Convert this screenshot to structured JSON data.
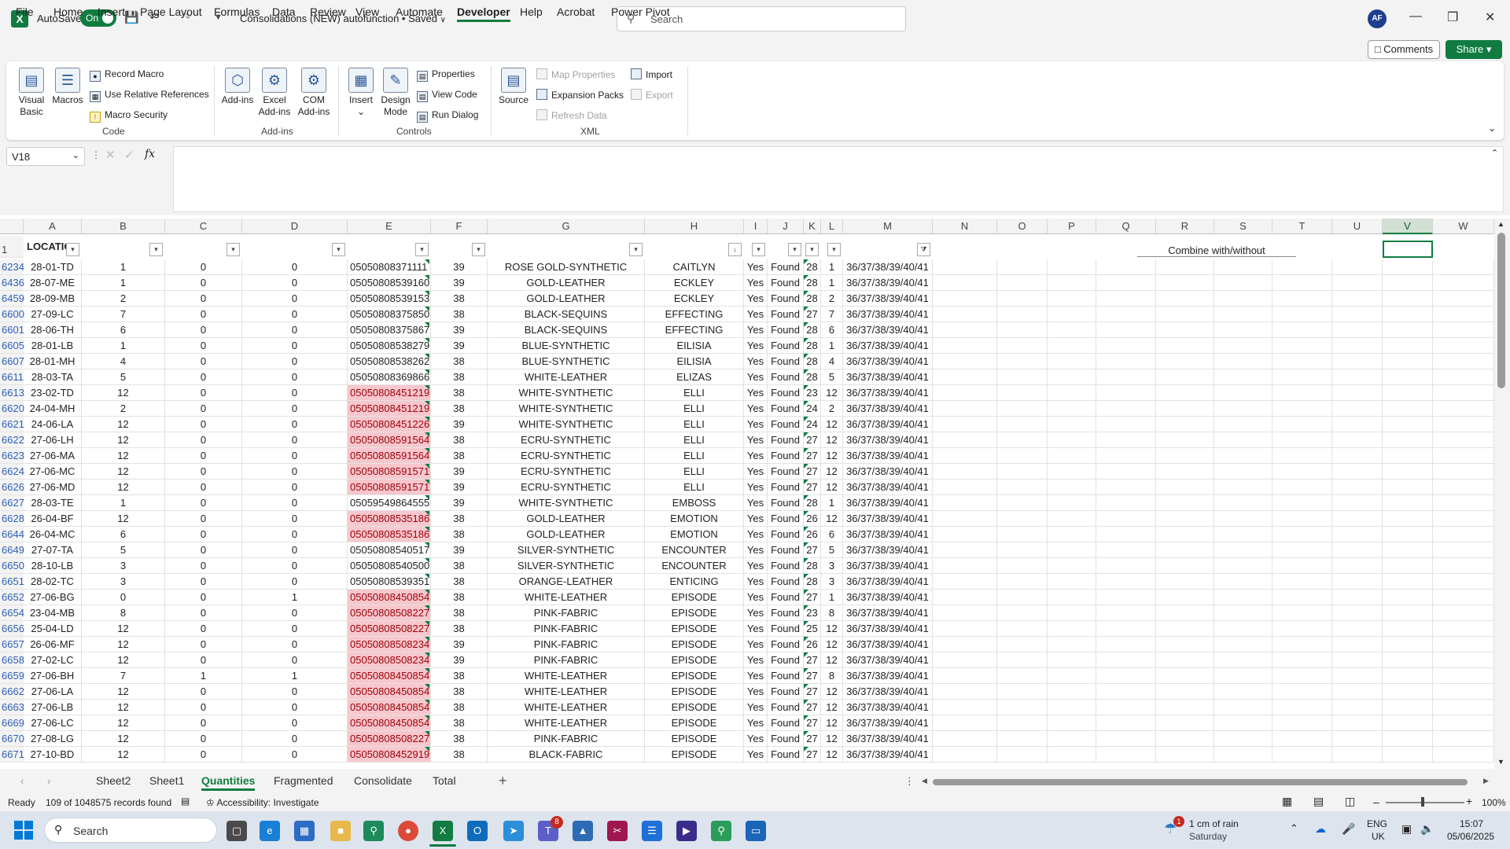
{
  "titlebar": {
    "autosave_label": "AutoSave",
    "toggle": "On",
    "doc_title": "Consolidations (NEW) autofunction • Saved",
    "search_placeholder": "Search",
    "avatar": "AF"
  },
  "menu": [
    "File",
    "Home",
    "Insert",
    "Page Layout",
    "Formulas",
    "Data",
    "Review",
    "View",
    "Automate",
    "Developer",
    "Help",
    "Acrobat",
    "Power Pivot"
  ],
  "menu_active": "Developer",
  "comments_label": "Comments",
  "share_label": "Share",
  "ribbon": {
    "code": {
      "visual_basic": "Visual Basic",
      "macros": "Macros",
      "record_macro": "Record Macro",
      "use_relative": "Use Relative References",
      "macro_security": "Macro Security",
      "label": "Code"
    },
    "addins": {
      "addins": "Add-ins",
      "excel_addins": "Excel Add-ins",
      "com_addins": "COM Add-ins",
      "label": "Add-ins"
    },
    "controls": {
      "insert": "Insert",
      "design_mode": "Design Mode",
      "properties": "Properties",
      "view_code": "View Code",
      "run_dialog": "Run Dialog",
      "label": "Controls"
    },
    "xml": {
      "source": "Source",
      "map_properties": "Map Properties",
      "expansion_packs": "Expansion Packs",
      "refresh_data": "Refresh Data",
      "import": "Import",
      "export": "Export",
      "label": "XML"
    }
  },
  "namebox": "V18",
  "fx": "fx",
  "columns": [
    "A",
    "B",
    "C",
    "D",
    "E",
    "F",
    "G",
    "H",
    "I",
    "J",
    "K",
    "L",
    "M",
    "N",
    "O",
    "P",
    "Q",
    "R",
    "S",
    "T",
    "U",
    "V",
    "W"
  ],
  "selected_column": "V",
  "header_row": {
    "num": "1",
    "a": "LOCATIC"
  },
  "combine_label": "Combine with/without",
  "rows": [
    {
      "n": "6234",
      "a": "28-01-TD",
      "b": "1",
      "c": "0",
      "d": "0",
      "e": "05050808371111",
      "red": false,
      "f": "39",
      "g": "ROSE GOLD-SYNTHETIC",
      "h": "CAITLYN",
      "i": "Yes",
      "j": "Found",
      "k": "28",
      "l": "1",
      "m": "36/37/38/39/40/41"
    },
    {
      "n": "6436",
      "a": "28-07-ME",
      "b": "1",
      "c": "0",
      "d": "0",
      "e": "05050808539160",
      "red": false,
      "f": "39",
      "g": "GOLD-LEATHER",
      "h": "ECKLEY",
      "i": "Yes",
      "j": "Found",
      "k": "28",
      "l": "1",
      "m": "36/37/38/39/40/41"
    },
    {
      "n": "6459",
      "a": "28-09-MB",
      "b": "2",
      "c": "0",
      "d": "0",
      "e": "05050808539153",
      "red": false,
      "f": "38",
      "g": "GOLD-LEATHER",
      "h": "ECKLEY",
      "i": "Yes",
      "j": "Found",
      "k": "28",
      "l": "2",
      "m": "36/37/38/39/40/41"
    },
    {
      "n": "6600",
      "a": "27-09-LC",
      "b": "7",
      "c": "0",
      "d": "0",
      "e": "05050808375850",
      "red": false,
      "f": "38",
      "g": "BLACK-SEQUINS",
      "h": "EFFECTING",
      "i": "Yes",
      "j": "Found",
      "k": "27",
      "l": "7",
      "m": "36/37/38/39/40/41"
    },
    {
      "n": "6601",
      "a": "28-06-TH",
      "b": "6",
      "c": "0",
      "d": "0",
      "e": "05050808375867",
      "red": false,
      "f": "39",
      "g": "BLACK-SEQUINS",
      "h": "EFFECTING",
      "i": "Yes",
      "j": "Found",
      "k": "28",
      "l": "6",
      "m": "36/37/38/39/40/41"
    },
    {
      "n": "6605",
      "a": "28-01-LB",
      "b": "1",
      "c": "0",
      "d": "0",
      "e": "05050808538279",
      "red": false,
      "f": "39",
      "g": "BLUE-SYNTHETIC",
      "h": "EILISIA",
      "i": "Yes",
      "j": "Found",
      "k": "28",
      "l": "1",
      "m": "36/37/38/39/40/41"
    },
    {
      "n": "6607",
      "a": "28-01-MH",
      "b": "4",
      "c": "0",
      "d": "0",
      "e": "05050808538262",
      "red": false,
      "f": "38",
      "g": "BLUE-SYNTHETIC",
      "h": "EILISIA",
      "i": "Yes",
      "j": "Found",
      "k": "28",
      "l": "4",
      "m": "36/37/38/39/40/41"
    },
    {
      "n": "6611",
      "a": "28-03-TA",
      "b": "5",
      "c": "0",
      "d": "0",
      "e": "05050808369866",
      "red": false,
      "f": "38",
      "g": "WHITE-LEATHER",
      "h": "ELIZAS",
      "i": "Yes",
      "j": "Found",
      "k": "28",
      "l": "5",
      "m": "36/37/38/39/40/41"
    },
    {
      "n": "6613",
      "a": "23-02-TD",
      "b": "12",
      "c": "0",
      "d": "0",
      "e": "05050808451219",
      "red": true,
      "f": "38",
      "g": "WHITE-SYNTHETIC",
      "h": "ELLI",
      "i": "Yes",
      "j": "Found",
      "k": "23",
      "l": "12",
      "m": "36/37/38/39/40/41"
    },
    {
      "n": "6620",
      "a": "24-04-MH",
      "b": "2",
      "c": "0",
      "d": "0",
      "e": "05050808451219",
      "red": true,
      "f": "38",
      "g": "WHITE-SYNTHETIC",
      "h": "ELLI",
      "i": "Yes",
      "j": "Found",
      "k": "24",
      "l": "2",
      "m": "36/37/38/39/40/41"
    },
    {
      "n": "6621",
      "a": "24-06-LA",
      "b": "12",
      "c": "0",
      "d": "0",
      "e": "05050808451226",
      "red": true,
      "f": "39",
      "g": "WHITE-SYNTHETIC",
      "h": "ELLI",
      "i": "Yes",
      "j": "Found",
      "k": "24",
      "l": "12",
      "m": "36/37/38/39/40/41"
    },
    {
      "n": "6622",
      "a": "27-06-LH",
      "b": "12",
      "c": "0",
      "d": "0",
      "e": "05050808591564",
      "red": true,
      "f": "38",
      "g": "ECRU-SYNTHETIC",
      "h": "ELLI",
      "i": "Yes",
      "j": "Found",
      "k": "27",
      "l": "12",
      "m": "36/37/38/39/40/41"
    },
    {
      "n": "6623",
      "a": "27-06-MA",
      "b": "12",
      "c": "0",
      "d": "0",
      "e": "05050808591564",
      "red": true,
      "f": "38",
      "g": "ECRU-SYNTHETIC",
      "h": "ELLI",
      "i": "Yes",
      "j": "Found",
      "k": "27",
      "l": "12",
      "m": "36/37/38/39/40/41"
    },
    {
      "n": "6624",
      "a": "27-06-MC",
      "b": "12",
      "c": "0",
      "d": "0",
      "e": "05050808591571",
      "red": true,
      "f": "39",
      "g": "ECRU-SYNTHETIC",
      "h": "ELLI",
      "i": "Yes",
      "j": "Found",
      "k": "27",
      "l": "12",
      "m": "36/37/38/39/40/41"
    },
    {
      "n": "6626",
      "a": "27-06-MD",
      "b": "12",
      "c": "0",
      "d": "0",
      "e": "05050808591571",
      "red": true,
      "f": "39",
      "g": "ECRU-SYNTHETIC",
      "h": "ELLI",
      "i": "Yes",
      "j": "Found",
      "k": "27",
      "l": "12",
      "m": "36/37/38/39/40/41"
    },
    {
      "n": "6627",
      "a": "28-03-TE",
      "b": "1",
      "c": "0",
      "d": "0",
      "e": "05059549864555",
      "red": false,
      "f": "39",
      "g": "WHITE-SYNTHETIC",
      "h": "EMBOSS",
      "i": "Yes",
      "j": "Found",
      "k": "28",
      "l": "1",
      "m": "36/37/38/39/40/41"
    },
    {
      "n": "6628",
      "a": "26-04-BF",
      "b": "12",
      "c": "0",
      "d": "0",
      "e": "05050808535186",
      "red": true,
      "f": "38",
      "g": "GOLD-LEATHER",
      "h": "EMOTION",
      "i": "Yes",
      "j": "Found",
      "k": "26",
      "l": "12",
      "m": "36/37/38/39/40/41"
    },
    {
      "n": "6644",
      "a": "26-04-MC",
      "b": "6",
      "c": "0",
      "d": "0",
      "e": "05050808535186",
      "red": true,
      "f": "38",
      "g": "GOLD-LEATHER",
      "h": "EMOTION",
      "i": "Yes",
      "j": "Found",
      "k": "26",
      "l": "6",
      "m": "36/37/38/39/40/41"
    },
    {
      "n": "6649",
      "a": "27-07-TA",
      "b": "5",
      "c": "0",
      "d": "0",
      "e": "05050808540517",
      "red": false,
      "f": "39",
      "g": "SILVER-SYNTHETIC",
      "h": "ENCOUNTER",
      "i": "Yes",
      "j": "Found",
      "k": "27",
      "l": "5",
      "m": "36/37/38/39/40/41"
    },
    {
      "n": "6650",
      "a": "28-10-LB",
      "b": "3",
      "c": "0",
      "d": "0",
      "e": "05050808540500",
      "red": false,
      "f": "38",
      "g": "SILVER-SYNTHETIC",
      "h": "ENCOUNTER",
      "i": "Yes",
      "j": "Found",
      "k": "28",
      "l": "3",
      "m": "36/37/38/39/40/41"
    },
    {
      "n": "6651",
      "a": "28-02-TC",
      "b": "3",
      "c": "0",
      "d": "0",
      "e": "05050808539351",
      "red": false,
      "f": "38",
      "g": "ORANGE-LEATHER",
      "h": "ENTICING",
      "i": "Yes",
      "j": "Found",
      "k": "28",
      "l": "3",
      "m": "36/37/38/39/40/41"
    },
    {
      "n": "6652",
      "a": "27-06-BG",
      "b": "0",
      "c": "0",
      "d": "1",
      "e": "05050808450854",
      "red": true,
      "f": "38",
      "g": "WHITE-LEATHER",
      "h": "EPISODE",
      "i": "Yes",
      "j": "Found",
      "k": "27",
      "l": "1",
      "m": "36/37/38/39/40/41"
    },
    {
      "n": "6654",
      "a": "23-04-MB",
      "b": "8",
      "c": "0",
      "d": "0",
      "e": "05050808508227",
      "red": true,
      "f": "38",
      "g": "PINK-FABRIC",
      "h": "EPISODE",
      "i": "Yes",
      "j": "Found",
      "k": "23",
      "l": "8",
      "m": "36/37/38/39/40/41"
    },
    {
      "n": "6656",
      "a": "25-04-LD",
      "b": "12",
      "c": "0",
      "d": "0",
      "e": "05050808508227",
      "red": true,
      "f": "38",
      "g": "PINK-FABRIC",
      "h": "EPISODE",
      "i": "Yes",
      "j": "Found",
      "k": "25",
      "l": "12",
      "m": "36/37/38/39/40/41"
    },
    {
      "n": "6657",
      "a": "26-06-MF",
      "b": "12",
      "c": "0",
      "d": "0",
      "e": "05050808508234",
      "red": true,
      "f": "39",
      "g": "PINK-FABRIC",
      "h": "EPISODE",
      "i": "Yes",
      "j": "Found",
      "k": "26",
      "l": "12",
      "m": "36/37/38/39/40/41"
    },
    {
      "n": "6658",
      "a": "27-02-LC",
      "b": "12",
      "c": "0",
      "d": "0",
      "e": "05050808508234",
      "red": true,
      "f": "39",
      "g": "PINK-FABRIC",
      "h": "EPISODE",
      "i": "Yes",
      "j": "Found",
      "k": "27",
      "l": "12",
      "m": "36/37/38/39/40/41"
    },
    {
      "n": "6659",
      "a": "27-06-BH",
      "b": "7",
      "c": "1",
      "d": "1",
      "e": "05050808450854",
      "red": true,
      "f": "38",
      "g": "WHITE-LEATHER",
      "h": "EPISODE",
      "i": "Yes",
      "j": "Found",
      "k": "27",
      "l": "8",
      "m": "36/37/38/39/40/41"
    },
    {
      "n": "6662",
      "a": "27-06-LA",
      "b": "12",
      "c": "0",
      "d": "0",
      "e": "05050808450854",
      "red": true,
      "f": "38",
      "g": "WHITE-LEATHER",
      "h": "EPISODE",
      "i": "Yes",
      "j": "Found",
      "k": "27",
      "l": "12",
      "m": "36/37/38/39/40/41"
    },
    {
      "n": "6663",
      "a": "27-06-LB",
      "b": "12",
      "c": "0",
      "d": "0",
      "e": "05050808450854",
      "red": true,
      "f": "38",
      "g": "WHITE-LEATHER",
      "h": "EPISODE",
      "i": "Yes",
      "j": "Found",
      "k": "27",
      "l": "12",
      "m": "36/37/38/39/40/41"
    },
    {
      "n": "6669",
      "a": "27-06-LC",
      "b": "12",
      "c": "0",
      "d": "0",
      "e": "05050808450854",
      "red": true,
      "f": "38",
      "g": "WHITE-LEATHER",
      "h": "EPISODE",
      "i": "Yes",
      "j": "Found",
      "k": "27",
      "l": "12",
      "m": "36/37/38/39/40/41"
    },
    {
      "n": "6670",
      "a": "27-08-LG",
      "b": "12",
      "c": "0",
      "d": "0",
      "e": "05050808508227",
      "red": true,
      "f": "38",
      "g": "PINK-FABRIC",
      "h": "EPISODE",
      "i": "Yes",
      "j": "Found",
      "k": "27",
      "l": "12",
      "m": "36/37/38/39/40/41"
    },
    {
      "n": "6671",
      "a": "27-10-BD",
      "b": "12",
      "c": "0",
      "d": "0",
      "e": "05050808452919",
      "red": true,
      "f": "38",
      "g": "BLACK-FABRIC",
      "h": "EPISODE",
      "i": "Yes",
      "j": "Found",
      "k": "27",
      "l": "12",
      "m": "36/37/38/39/40/41"
    }
  ],
  "sheets": [
    "Sheet2",
    "Sheet1",
    "Quantities",
    "Fragmented",
    "Consolidate",
    "Total"
  ],
  "active_sheet": "Quantities",
  "status": {
    "ready": "Ready",
    "records": "109 of 1048575 records found",
    "accessibility": "Accessibility: Investigate",
    "zoom": "100%"
  },
  "taskbar": {
    "search": "Search",
    "weather_line1": "1 cm of rain",
    "weather_line2": "Saturday",
    "weather_badge": "1",
    "lang1": "ENG",
    "lang2": "UK",
    "time": "15:07",
    "date": "05/06/2025",
    "teams_badge": "8"
  },
  "colors": {
    "excel_green": "#107c41",
    "dup_fill": "#f8c7ce",
    "dup_text": "#9c0006"
  }
}
